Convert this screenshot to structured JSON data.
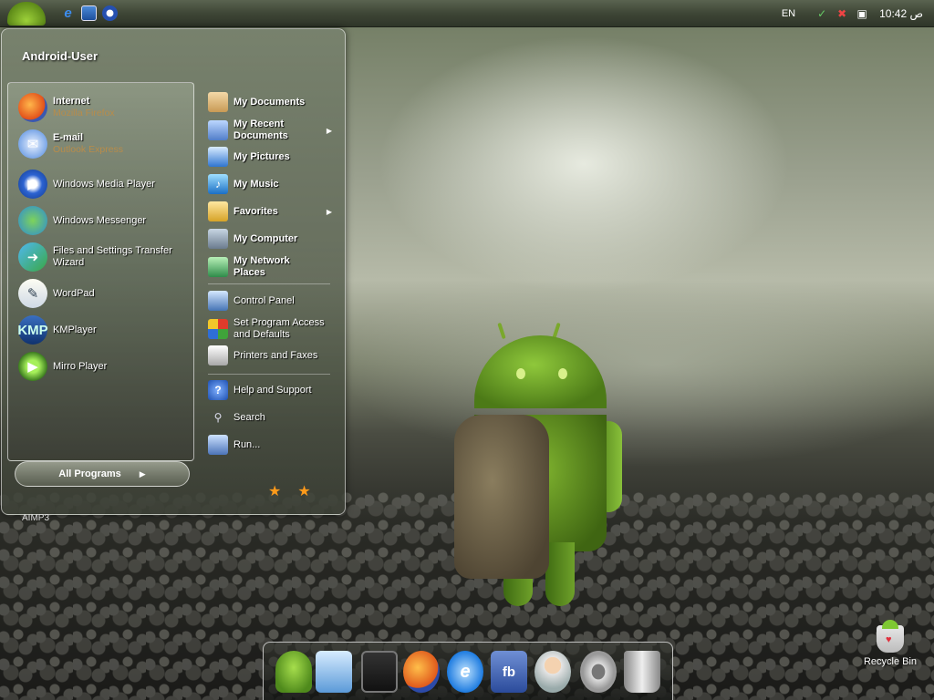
{
  "taskbar": {
    "language": "EN",
    "clock": "10:42 ص"
  },
  "start_menu": {
    "user_name": "Android-User",
    "pinned": [
      {
        "title": "Internet",
        "subtitle": "Mozilla Firefox",
        "icon": "firefox-icon"
      },
      {
        "title": "E-mail",
        "subtitle": "Outlook Express",
        "icon": "email-icon"
      }
    ],
    "recent": [
      {
        "title": "Windows Media Player",
        "icon": "windows-media-player-icon"
      },
      {
        "title": "Windows Messenger",
        "icon": "windows-messenger-icon"
      },
      {
        "title": "Files and Settings Transfer Wizard",
        "icon": "transfer-wizard-icon"
      },
      {
        "title": "WordPad",
        "icon": "wordpad-icon"
      },
      {
        "title": "KMPlayer",
        "icon": "kmplayer-icon"
      },
      {
        "title": "Mirro Player",
        "icon": "mirro-player-icon"
      }
    ],
    "all_programs": "All Programs",
    "right": [
      {
        "label": "My Documents",
        "icon": "my-documents-icon"
      },
      {
        "label": "My Recent Documents",
        "icon": "my-recent-documents-icon"
      },
      {
        "label": "My Pictures",
        "icon": "my-pictures-icon"
      },
      {
        "label": "My Music",
        "icon": "my-music-icon"
      },
      {
        "label": "Favorites",
        "icon": "favorites-icon"
      },
      {
        "label": "My Computer",
        "icon": "my-computer-icon"
      },
      {
        "label": "My Network Places",
        "icon": "my-network-places-icon"
      },
      {
        "label": "Control Panel",
        "icon": "control-panel-icon"
      },
      {
        "label": "Set Program Access and Defaults",
        "icon": "program-access-icon"
      },
      {
        "label": "Printers and Faxes",
        "icon": "printer-icon"
      },
      {
        "label": "Help and Support",
        "icon": "help-icon"
      },
      {
        "label": "Search",
        "icon": "search-icon"
      },
      {
        "label": "Run...",
        "icon": "run-icon"
      }
    ]
  },
  "desktop": {
    "aimp_label": "AIMP3",
    "recycle_bin": "Recycle Bin"
  },
  "dock": {
    "icons": [
      "android-icon",
      "monitor-icon",
      "tablet-icon",
      "firefox-icon",
      "internet-explorer-icon",
      "facebook-icon",
      "user-support-icon",
      "settings-gear-icon",
      "trash-can-icon"
    ],
    "fb_text": "fb"
  },
  "colors": {
    "accent_green": "#8fc83b",
    "subtitle_brown": "#b88c4a"
  }
}
